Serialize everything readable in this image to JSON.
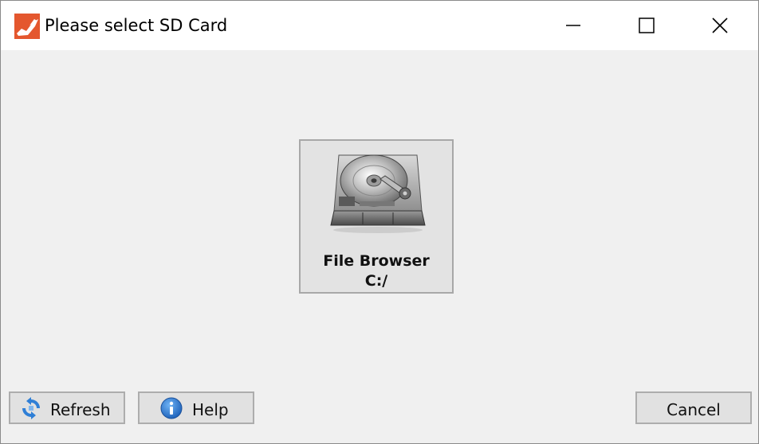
{
  "window": {
    "title": "Please select SD Card",
    "accent_color": "#e4572e"
  },
  "device": {
    "name": "File Browser",
    "path": "C:/",
    "icon": "hard-drive-icon"
  },
  "buttons": {
    "refresh": "Refresh",
    "help": "Help",
    "cancel": "Cancel"
  }
}
